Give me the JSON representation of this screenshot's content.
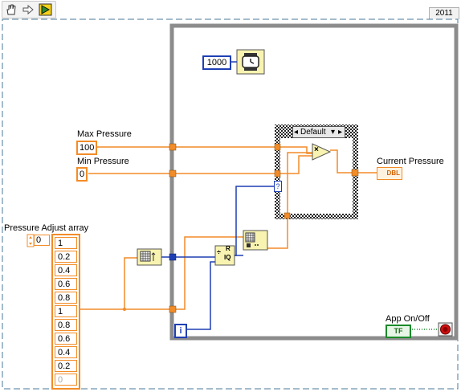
{
  "toolbar": {
    "icons": [
      "hand-pointer-icon",
      "arrow-right-icon",
      "run-highlight-icon"
    ]
  },
  "year_tab": "2011",
  "labels": {
    "max_pressure": "Max Pressure",
    "min_pressure": "Min Pressure",
    "pressure_adjust_array": "Pressure Adjust array",
    "current_pressure": "Current Pressure",
    "app_on_off": "App On/Off"
  },
  "controls": {
    "max_pressure_value": "100",
    "min_pressure_value": "0",
    "array_index": "0",
    "wait_ms": "1000",
    "current_pressure_type": "DBL",
    "app_on_off_type": "TF",
    "iteration_terminal": "i"
  },
  "pressure_adjust_array": [
    "1",
    "0.2",
    "0.4",
    "0.6",
    "0.8",
    "1",
    "0.8",
    "0.6",
    "0.4",
    "0.2",
    "0"
  ],
  "case_structure": {
    "selector": "Default",
    "question_terminal": "?"
  },
  "nodes": {
    "multiply": "×",
    "quotient_top": "R",
    "quotient_bottom": "IQ"
  },
  "colors": {
    "numeric_wire": "#f28c28",
    "integer_wire": "#1e3fb4",
    "boolean_wire": "#1a8a2a",
    "loop_border": "#8c8c8c",
    "stop_red": "#d01010"
  }
}
